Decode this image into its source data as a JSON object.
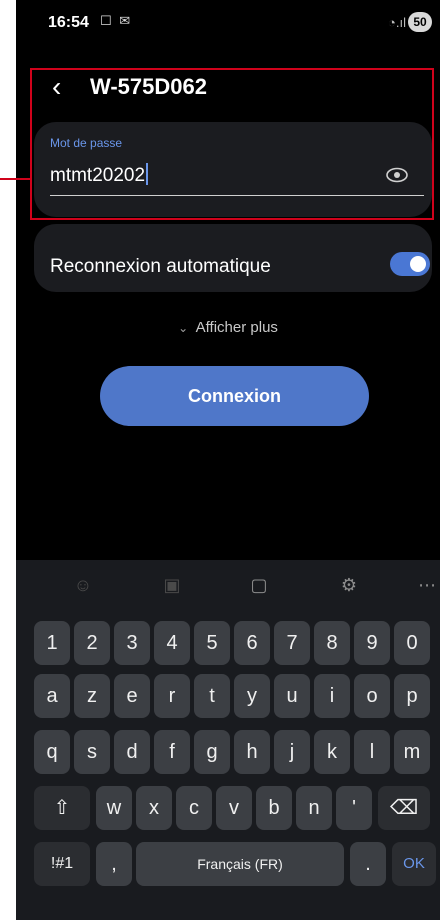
{
  "status_bar": {
    "time": "16:54",
    "icons": "☐ ✉",
    "battery": "50"
  },
  "header": {
    "title": "W-575D062"
  },
  "password": {
    "label": "Mot de passe",
    "value": "mtmt20202"
  },
  "auto_reconnect": {
    "label": "Reconnexion automatique",
    "enabled": true
  },
  "show_more": {
    "label": "Afficher plus"
  },
  "connect_button": {
    "label": "Connexion"
  },
  "keyboard": {
    "toolbar": [
      "emoji-icon",
      "sticker-icon",
      "clipboard-icon",
      "settings-icon",
      "more-icon"
    ],
    "row_numbers": [
      "1",
      "2",
      "3",
      "4",
      "5",
      "6",
      "7",
      "8",
      "9",
      "0"
    ],
    "row1": [
      "a",
      "z",
      "e",
      "r",
      "t",
      "y",
      "u",
      "i",
      "o",
      "p"
    ],
    "row2": [
      "q",
      "s",
      "d",
      "f",
      "g",
      "h",
      "j",
      "k",
      "l",
      "m"
    ],
    "row3": [
      "w",
      "x",
      "c",
      "v",
      "b",
      "n",
      "'"
    ],
    "symbols": "!#1",
    "comma": ",",
    "space": "Français (FR)",
    "period": ".",
    "ok": "OK"
  }
}
